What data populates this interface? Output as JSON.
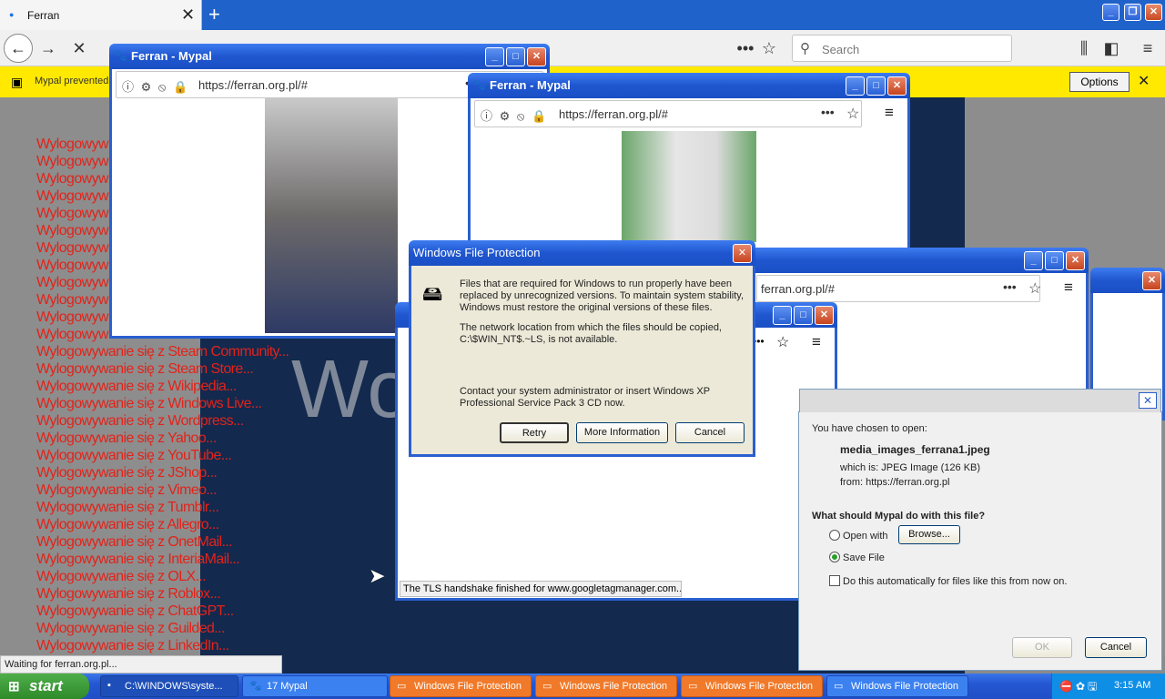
{
  "browser": {
    "tab_title": "Ferran",
    "search_placeholder": "Search",
    "notification": "Mypal prevented",
    "options_label": "Options",
    "status": "Waiting for ferran.org.pl..."
  },
  "page": {
    "big_word": "Wo",
    "logout_items": [
      "Wylogowyw",
      "Wylogowyw",
      "Wylogowyw",
      "Wylogowyw",
      "Wylogowyw",
      "Wylogowyw",
      "Wylogowyw",
      "Wylogowyw",
      "Wylogowyw",
      "Wylogowyw",
      "Wylogowyw",
      "Wylogowyw",
      "Wylogowywanie się z Steam Community...",
      "Wylogowywanie się z Steam Store...",
      "Wylogowywanie się z Wikipedia...",
      "Wylogowywanie się z Windows Live...",
      "Wylogowywanie się z Wordpress...",
      "Wylogowywanie się z Yahoo...",
      "Wylogowywanie się z YouTube...",
      "Wylogowywanie się z JShop...",
      "Wylogowywanie się z Vimeo...",
      "Wylogowywanie się z Tumblr...",
      "Wylogowywanie się z Allegro...",
      "Wylogowywanie się z OnetMail...",
      "Wylogowywanie się z InteriaMail...",
      "Wylogowywanie się z OLX...",
      "Wylogowywanie się z Roblox...",
      "Wylogowywanie się z ChatGPT...",
      "Wylogowywanie się z Guilded...",
      "Wylogowywanie się z LinkedIn..."
    ]
  },
  "popups": {
    "title": "Ferran - Mypal",
    "url": "https://ferran.org.pl/#",
    "url_partial": "ferran.org.pl/#",
    "status": "The TLS handshake finished for www.googletagmanager.com..."
  },
  "wfp": {
    "title": "Windows File Protection",
    "para1": "Files that are required for Windows to run properly have been replaced by unrecognized versions.  To maintain system stability, Windows must restore the original versions of these files.",
    "para2": "The network location from which the files should be copied, C:\\$WIN_NT$.~LS, is not available.",
    "para3": "Contact your system administrator or insert Windows XP Professional Service Pack 3 CD now.",
    "retry": "Retry",
    "more_info": "More Information",
    "cancel": "Cancel"
  },
  "download": {
    "chosen": "You have chosen to open:",
    "filename": "media_images_ferrana1.jpeg",
    "which_is": "which is:  JPEG Image (126 KB)",
    "from": "from:  https://ferran.org.pl",
    "question": "What should Mypal do with this file?",
    "open_with": "Open with",
    "browse": "Browse...",
    "save_file": "Save File",
    "auto": "Do this automatically for files like this from now on.",
    "ok": "OK",
    "cancel": "Cancel"
  },
  "taskbar": {
    "start": "start",
    "cmd": "C:\\WINDOWS\\syste...",
    "mypal": "17 Mypal",
    "wfp1": "Windows File Protection",
    "wfp2": "Windows File Protection",
    "wfp3": "Windows File Protection",
    "wfp4": "Windows File Protection",
    "clock": "3:15 AM"
  },
  "colors": {
    "xp_blue": "#2a5fd0",
    "logout_red": "#e2231a",
    "notif_yellow": "#ffe900"
  }
}
